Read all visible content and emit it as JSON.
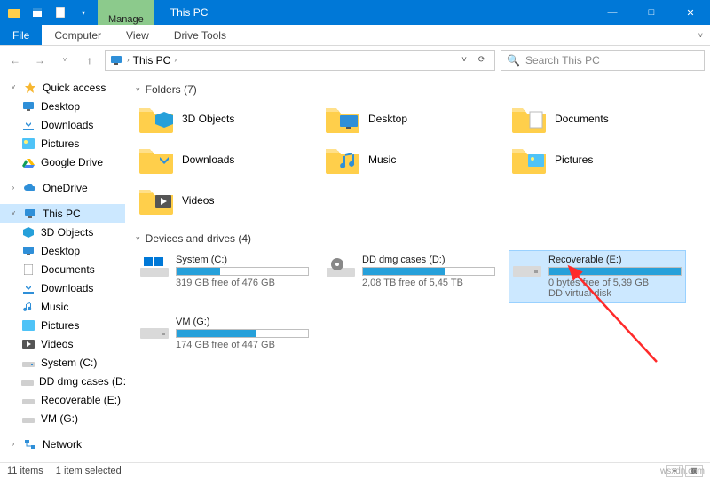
{
  "titlebar": {
    "title": "This PC",
    "ctx_tab": "Manage"
  },
  "window_controls": {
    "min": "—",
    "max": "□",
    "close": "✕"
  },
  "ribbon": {
    "file": "File",
    "tabs": [
      "Computer",
      "View",
      "Drive Tools"
    ]
  },
  "nav": {
    "back": "←",
    "fwd": "→",
    "up": "↑"
  },
  "address": {
    "root_icon": "pc",
    "segments": [
      "This PC"
    ],
    "chev": "›"
  },
  "search": {
    "placeholder": "Search This PC",
    "icon": "🔍"
  },
  "sidebar": {
    "quick": {
      "label": "Quick access",
      "items": [
        "Desktop",
        "Downloads",
        "Pictures",
        "Google Drive"
      ]
    },
    "onedrive": "OneDrive",
    "thispc": {
      "label": "This PC",
      "items": [
        "3D Objects",
        "Desktop",
        "Documents",
        "Downloads",
        "Music",
        "Pictures",
        "Videos",
        "System (C:)",
        "DD dmg cases (D:)",
        "Recoverable (E:)",
        "VM (G:)"
      ]
    },
    "network": "Network"
  },
  "sections": {
    "folders": {
      "title": "Folders (7)",
      "items": [
        "3D Objects",
        "Desktop",
        "Documents",
        "Downloads",
        "Music",
        "Pictures",
        "Videos"
      ]
    },
    "drives": {
      "title": "Devices and drives (4)",
      "items": [
        {
          "name": "System (C:)",
          "free": "319 GB free of 476 GB",
          "fill": 0.33,
          "kind": "win"
        },
        {
          "name": "DD dmg cases (D:)",
          "free": "2,08 TB free of 5,45 TB",
          "fill": 0.62,
          "kind": "img"
        },
        {
          "name": "Recoverable (E:)",
          "free": "0 bytes free of 5,39 GB",
          "sub": "DD virtual disk",
          "fill": 1.0,
          "kind": "hdd",
          "selected": true
        },
        {
          "name": "VM (G:)",
          "free": "174 GB free of 447 GB",
          "fill": 0.61,
          "kind": "hdd"
        }
      ]
    }
  },
  "statusbar": {
    "count": "11 items",
    "sel": "1 item selected"
  },
  "watermark": "wsxdn.com"
}
